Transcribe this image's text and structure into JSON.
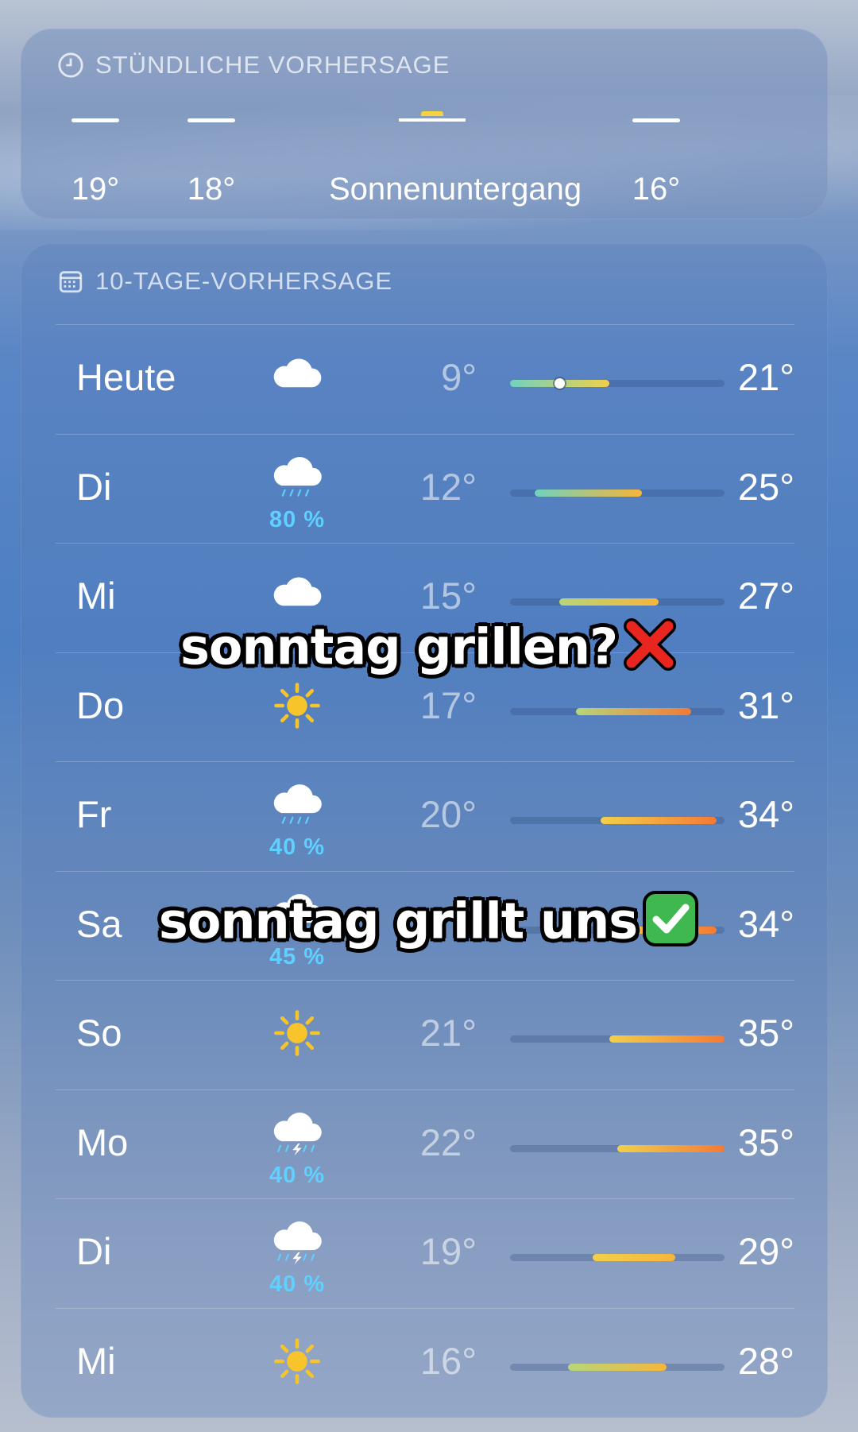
{
  "hourly": {
    "title": "STÜNDLICHE VORHERSAGE",
    "items": [
      {
        "label": "19°",
        "symbol": "cloud-dash-icon"
      },
      {
        "label": "18°",
        "symbol": "cloud-dash-icon"
      },
      {
        "label": "Sonnenuntergang",
        "symbol": "sunset-icon"
      },
      {
        "label": "16°",
        "symbol": "cloud-dash-icon"
      }
    ]
  },
  "daily": {
    "title": "10-TAGE-VORHERSAGE",
    "days": [
      {
        "day": "Heute",
        "icon": "cloud-icon",
        "precip": "",
        "low": "9°",
        "high": "21°",
        "low_val": 9,
        "high_val": 21,
        "current_val": 15
      },
      {
        "day": "Di",
        "icon": "cloud-rain-icon",
        "precip": "80 %",
        "low": "12°",
        "high": "25°",
        "low_val": 12,
        "high_val": 25
      },
      {
        "day": "Mi",
        "icon": "cloud-icon",
        "precip": "",
        "low": "15°",
        "high": "27°",
        "low_val": 15,
        "high_val": 27
      },
      {
        "day": "Do",
        "icon": "sun-icon",
        "precip": "",
        "low": "17°",
        "high": "31°",
        "low_val": 17,
        "high_val": 31
      },
      {
        "day": "Fr",
        "icon": "cloud-rain-icon",
        "precip": "40 %",
        "low": "20°",
        "high": "34°",
        "low_val": 20,
        "high_val": 34
      },
      {
        "day": "Sa",
        "icon": "sun-cloud-rain-icon",
        "precip": "45 %",
        "low": "",
        "high": "34°",
        "low_val": 21,
        "high_val": 34
      },
      {
        "day": "So",
        "icon": "sun-icon",
        "precip": "",
        "low": "21°",
        "high": "35°",
        "low_val": 21,
        "high_val": 35
      },
      {
        "day": "Mo",
        "icon": "cloud-bolt-rain-icon",
        "precip": "40 %",
        "low": "22°",
        "high": "35°",
        "low_val": 22,
        "high_val": 35
      },
      {
        "day": "Di",
        "icon": "cloud-bolt-rain-icon",
        "precip": "40 %",
        "low": "19°",
        "high": "29°",
        "low_val": 19,
        "high_val": 29
      },
      {
        "day": "Mi",
        "icon": "sun-icon",
        "precip": "",
        "low": "16°",
        "high": "28°",
        "low_val": 16,
        "high_val": 28
      }
    ],
    "range_min": 9,
    "range_max": 35
  },
  "overlay": {
    "caption_1": "sonntag grillen?",
    "caption_1_emoji": "cross-mark-icon",
    "caption_2": "sonntag grillt uns",
    "caption_2_emoji": "check-mark-icon"
  },
  "colors": {
    "precip": "#5fd0ff",
    "sun": "#f7c52b",
    "cross": "#e8251f",
    "check": "#3fb94f"
  }
}
